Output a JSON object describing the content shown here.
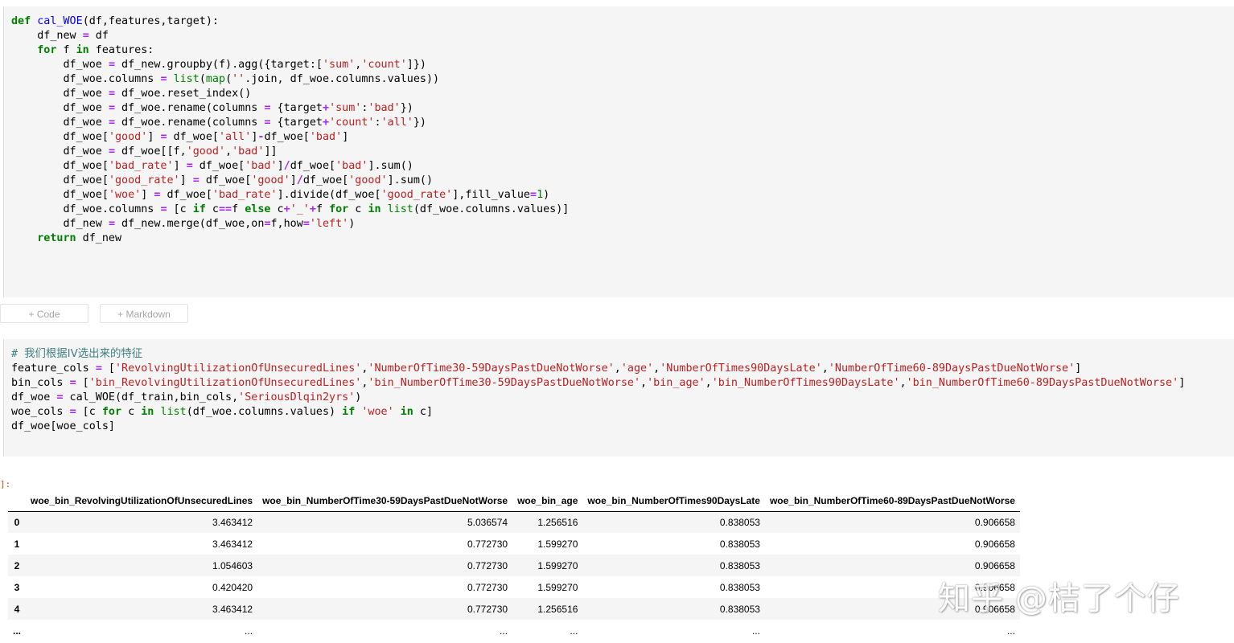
{
  "cell1": {
    "lines": [
      [
        [
          "kw",
          "def"
        ],
        [
          "t",
          " "
        ],
        [
          "fn",
          "cal_WOE"
        ],
        [
          "t",
          "(df,features,target):"
        ]
      ],
      [
        [
          "t",
          "    df_new "
        ],
        [
          "op",
          "="
        ],
        [
          "t",
          " df"
        ]
      ],
      [
        [
          "t",
          "    "
        ],
        [
          "kw",
          "for"
        ],
        [
          "t",
          " f "
        ],
        [
          "kw",
          "in"
        ],
        [
          "t",
          " features:"
        ]
      ],
      [
        [
          "t",
          "        df_woe "
        ],
        [
          "op",
          "="
        ],
        [
          "t",
          " df_new.groupby(f).agg({target:["
        ],
        [
          "st",
          "'sum'"
        ],
        [
          "t",
          ","
        ],
        [
          "st",
          "'count'"
        ],
        [
          "t",
          "]})"
        ]
      ],
      [
        [
          "t",
          "        df_woe.columns "
        ],
        [
          "op",
          "="
        ],
        [
          "t",
          " "
        ],
        [
          "bi",
          "list"
        ],
        [
          "t",
          "("
        ],
        [
          "bi",
          "map"
        ],
        [
          "t",
          "("
        ],
        [
          "st",
          "''"
        ],
        [
          "t",
          ".join, df_woe.columns.values))"
        ]
      ],
      [
        [
          "t",
          "        df_woe "
        ],
        [
          "op",
          "="
        ],
        [
          "t",
          " df_woe.reset_index()"
        ]
      ],
      [
        [
          "t",
          "        df_woe "
        ],
        [
          "op",
          "="
        ],
        [
          "t",
          " df_woe.rename(columns "
        ],
        [
          "op",
          "="
        ],
        [
          "t",
          " {target"
        ],
        [
          "op",
          "+"
        ],
        [
          "st",
          "'sum'"
        ],
        [
          "t",
          ":"
        ],
        [
          "st",
          "'bad'"
        ],
        [
          "t",
          "})"
        ]
      ],
      [
        [
          "t",
          "        df_woe "
        ],
        [
          "op",
          "="
        ],
        [
          "t",
          " df_woe.rename(columns "
        ],
        [
          "op",
          "="
        ],
        [
          "t",
          " {target"
        ],
        [
          "op",
          "+"
        ],
        [
          "st",
          "'count'"
        ],
        [
          "t",
          ":"
        ],
        [
          "st",
          "'all'"
        ],
        [
          "t",
          "})"
        ]
      ],
      [
        [
          "t",
          "        df_woe["
        ],
        [
          "st",
          "'good'"
        ],
        [
          "t",
          "] "
        ],
        [
          "op",
          "="
        ],
        [
          "t",
          " df_woe["
        ],
        [
          "st",
          "'all'"
        ],
        [
          "t",
          "]"
        ],
        [
          "op",
          "-"
        ],
        [
          "t",
          "df_woe["
        ],
        [
          "st",
          "'bad'"
        ],
        [
          "t",
          "]"
        ]
      ],
      [
        [
          "t",
          "        df_woe "
        ],
        [
          "op",
          "="
        ],
        [
          "t",
          " df_woe[[f,"
        ],
        [
          "st",
          "'good'"
        ],
        [
          "t",
          ","
        ],
        [
          "st",
          "'bad'"
        ],
        [
          "t",
          "]]"
        ]
      ],
      [
        [
          "t",
          "        df_woe["
        ],
        [
          "st",
          "'bad_rate'"
        ],
        [
          "t",
          "] "
        ],
        [
          "op",
          "="
        ],
        [
          "t",
          " df_woe["
        ],
        [
          "st",
          "'bad'"
        ],
        [
          "t",
          "]"
        ],
        [
          "op",
          "/"
        ],
        [
          "t",
          "df_woe["
        ],
        [
          "st",
          "'bad'"
        ],
        [
          "t",
          "].sum()"
        ]
      ],
      [
        [
          "t",
          "        df_woe["
        ],
        [
          "st",
          "'good_rate'"
        ],
        [
          "t",
          "] "
        ],
        [
          "op",
          "="
        ],
        [
          "t",
          " df_woe["
        ],
        [
          "st",
          "'good'"
        ],
        [
          "t",
          "]"
        ],
        [
          "op",
          "/"
        ],
        [
          "t",
          "df_woe["
        ],
        [
          "st",
          "'good'"
        ],
        [
          "t",
          "].sum()"
        ]
      ],
      [
        [
          "t",
          "        df_woe["
        ],
        [
          "st",
          "'woe'"
        ],
        [
          "t",
          "] "
        ],
        [
          "op",
          "="
        ],
        [
          "t",
          " df_woe["
        ],
        [
          "st",
          "'bad_rate'"
        ],
        [
          "t",
          "].divide(df_woe["
        ],
        [
          "st",
          "'good_rate'"
        ],
        [
          "t",
          "],fill_value"
        ],
        [
          "op",
          "="
        ],
        [
          "nu",
          "1"
        ],
        [
          "t",
          ")"
        ]
      ],
      [
        [
          "t",
          "        df_woe.columns "
        ],
        [
          "op",
          "="
        ],
        [
          "t",
          " [c "
        ],
        [
          "kw",
          "if"
        ],
        [
          "t",
          " c"
        ],
        [
          "op",
          "=="
        ],
        [
          "t",
          "f "
        ],
        [
          "kw",
          "else"
        ],
        [
          "t",
          " c"
        ],
        [
          "op",
          "+"
        ],
        [
          "st",
          "'_'"
        ],
        [
          "op",
          "+"
        ],
        [
          "t",
          "f "
        ],
        [
          "kw",
          "for"
        ],
        [
          "t",
          " c "
        ],
        [
          "kw",
          "in"
        ],
        [
          "t",
          " "
        ],
        [
          "bi",
          "list"
        ],
        [
          "t",
          "(df_woe.columns.values)]"
        ]
      ],
      [
        [
          "t",
          "        df_new "
        ],
        [
          "op",
          "="
        ],
        [
          "t",
          " df_new.merge(df_woe,on"
        ],
        [
          "op",
          "="
        ],
        [
          "t",
          "f,how"
        ],
        [
          "op",
          "="
        ],
        [
          "st",
          "'left'"
        ],
        [
          "t",
          ")"
        ]
      ],
      [
        [
          "t",
          "    "
        ],
        [
          "kw",
          "return"
        ],
        [
          "t",
          " df_new"
        ]
      ]
    ]
  },
  "buttons": {
    "add_code": "+ Code",
    "add_markdown": "+ Markdown"
  },
  "cell2": {
    "lines": [
      [
        [
          "cm",
          "# "
        ],
        [
          "cmcjk",
          "我们根据IV选出来的特征"
        ]
      ],
      [
        [
          "t",
          "feature_cols "
        ],
        [
          "op",
          "="
        ],
        [
          "t",
          " ["
        ],
        [
          "st",
          "'RevolvingUtilizationOfUnsecuredLines'"
        ],
        [
          "t",
          ","
        ],
        [
          "st",
          "'NumberOfTime30-59DaysPastDueNotWorse'"
        ],
        [
          "t",
          ","
        ],
        [
          "st",
          "'age'"
        ],
        [
          "t",
          ","
        ],
        [
          "st",
          "'NumberOfTimes90DaysLate'"
        ],
        [
          "t",
          ","
        ],
        [
          "st",
          "'NumberOfTime60-89DaysPastDueNotWorse'"
        ],
        [
          "t",
          "]"
        ]
      ],
      [
        [
          "t",
          "bin_cols "
        ],
        [
          "op",
          "="
        ],
        [
          "t",
          " ["
        ],
        [
          "st",
          "'bin_RevolvingUtilizationOfUnsecuredLines'"
        ],
        [
          "t",
          ","
        ],
        [
          "st",
          "'bin_NumberOfTime30-59DaysPastDueNotWorse'"
        ],
        [
          "t",
          ","
        ],
        [
          "st",
          "'bin_age'"
        ],
        [
          "t",
          ","
        ],
        [
          "st",
          "'bin_NumberOfTimes90DaysLate'"
        ],
        [
          "t",
          ","
        ],
        [
          "st",
          "'bin_NumberOfTime60-89DaysPastDueNotWorse'"
        ],
        [
          "t",
          "]"
        ]
      ],
      [
        [
          "t",
          "df_woe "
        ],
        [
          "op",
          "="
        ],
        [
          "t",
          " cal_WOE(df_train,bin_cols,"
        ],
        [
          "st",
          "'SeriousDlqin2yrs'"
        ],
        [
          "t",
          ")"
        ]
      ],
      [
        [
          "t",
          "woe_cols "
        ],
        [
          "op",
          "="
        ],
        [
          "t",
          " [c "
        ],
        [
          "kw",
          "for"
        ],
        [
          "t",
          " c "
        ],
        [
          "kw",
          "in"
        ],
        [
          "t",
          " "
        ],
        [
          "bi",
          "list"
        ],
        [
          "t",
          "(df_woe.columns.values) "
        ],
        [
          "kw",
          "if"
        ],
        [
          "t",
          " "
        ],
        [
          "st",
          "'woe'"
        ],
        [
          "t",
          " "
        ],
        [
          "kw",
          "in"
        ],
        [
          "t",
          " c]"
        ]
      ],
      [
        [
          "t",
          "df_woe[woe_cols]"
        ]
      ]
    ]
  },
  "output": {
    "prompt": "]:",
    "columns": [
      "woe_bin_RevolvingUtilizationOfUnsecuredLines",
      "woe_bin_NumberOfTime30-59DaysPastDueNotWorse",
      "woe_bin_age",
      "woe_bin_NumberOfTimes90DaysLate",
      "woe_bin_NumberOfTime60-89DaysPastDueNotWorse"
    ],
    "rows": [
      {
        "index": "0",
        "values": [
          "3.463412",
          "5.036574",
          "1.256516",
          "0.838053",
          "0.906658"
        ]
      },
      {
        "index": "1",
        "values": [
          "3.463412",
          "0.772730",
          "1.599270",
          "0.838053",
          "0.906658"
        ]
      },
      {
        "index": "2",
        "values": [
          "1.054603",
          "0.772730",
          "1.599270",
          "0.838053",
          "0.906658"
        ]
      },
      {
        "index": "3",
        "values": [
          "0.420420",
          "0.772730",
          "1.599270",
          "0.838053",
          "0.906658"
        ]
      },
      {
        "index": "4",
        "values": [
          "3.463412",
          "0.772730",
          "1.256516",
          "0.838053",
          "0.906658"
        ]
      },
      {
        "index": "...",
        "values": [
          "...",
          "...",
          "...",
          "...",
          "..."
        ]
      }
    ]
  },
  "watermark": "知乎 @桔了个仔"
}
